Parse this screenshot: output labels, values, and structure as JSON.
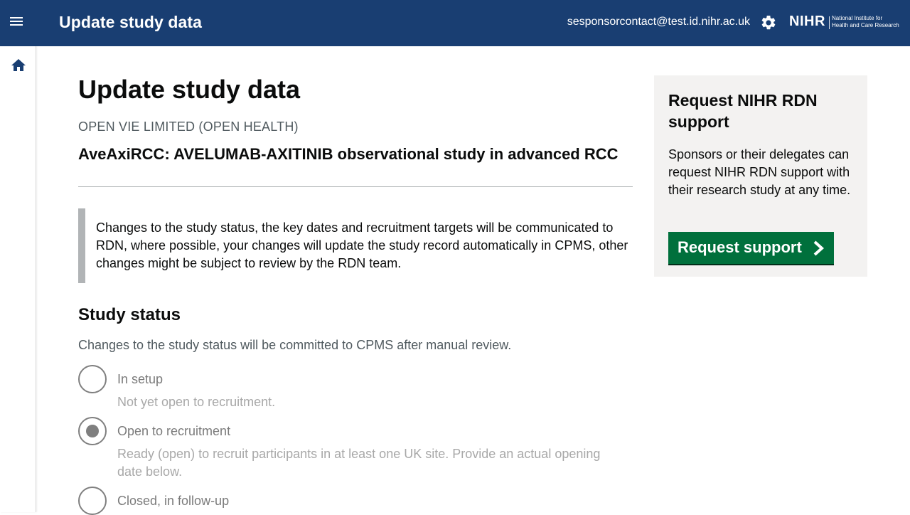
{
  "header": {
    "app_title": "Update study data",
    "user_email": "sesponsorcontact@test.id.nihr.ac.uk",
    "menu_icon": "hamburger-menu-icon",
    "settings_icon": "gear-icon",
    "logo_text": "NIHR",
    "logo_subtitle_line1": "National Institute for",
    "logo_subtitle_line2": "Health and Care Research",
    "background_color": "#193e72"
  },
  "sidebar": {
    "home_icon": "home-icon"
  },
  "main": {
    "page_title": "Update study data",
    "organisation": "OPEN VIE LIMITED (OPEN HEALTH)",
    "study_title": "AveAxiRCC: AVELUMAB-AXITINIB observational study in advanced RCC",
    "inset_text": "Changes to the study status, the key dates and recruitment targets will be communicated to RDN, where possible, your changes will update the study record automatically in CPMS, other changes might be subject to review by the RDN team.",
    "study_status": {
      "title": "Study status",
      "hint": "Changes to the study status will be committed to CPMS after manual review.",
      "options": [
        {
          "label": "In setup",
          "hint": "Not yet open to recruitment.",
          "selected": false
        },
        {
          "label": "Open to recruitment",
          "hint": "Ready (open) to recruit participants in at least one UK site. Provide an actual opening date below.",
          "selected": true
        },
        {
          "label": "Closed, in follow-up",
          "hint": "",
          "selected": false
        }
      ]
    }
  },
  "aside": {
    "title": "Request NIHR RDN support",
    "text": "Sponsors or their delegates can request NIHR RDN support with their research study at any time.",
    "button_label": "Request support",
    "button_icon": "chevron-right-icon",
    "button_color": "#00703c"
  }
}
